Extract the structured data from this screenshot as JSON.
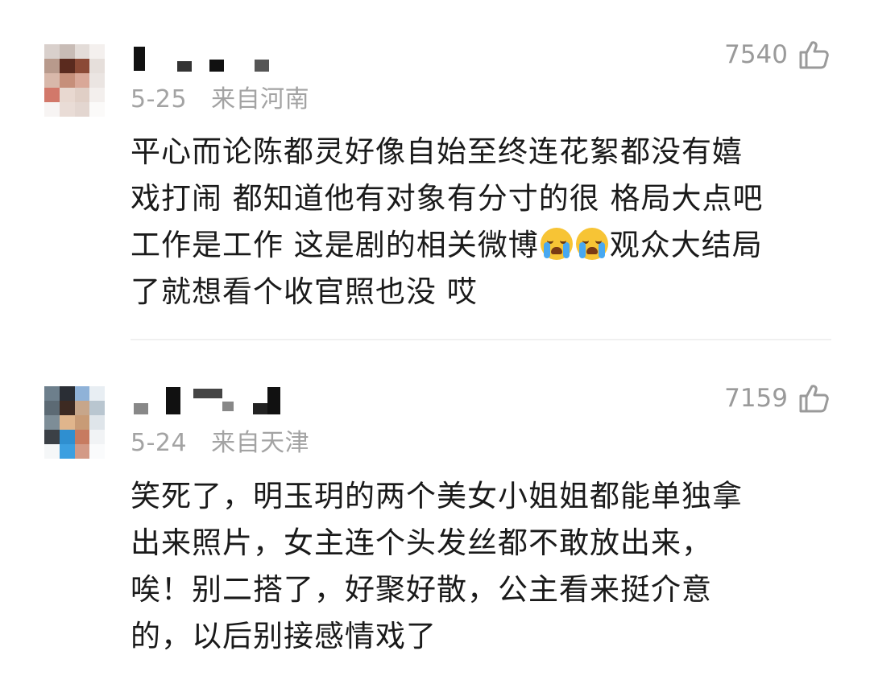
{
  "comments": [
    {
      "date": "5-25",
      "location": "来自河南",
      "likes": "7540",
      "text_a": "平心而论陈都灵好像自始至终连花絮都没有嬉\n戏打闹 都知道他有对象有分寸的很 格局大点吧\n工作是工作 这是剧的相关微博",
      "emoji": "crying-face-emoji",
      "text_b": "观众大结局\n了就想看个收官照也没 哎"
    },
    {
      "date": "5-24",
      "location": "来自天津",
      "likes": "7159",
      "text": "笑死了，明玉玥的两个美女小姐姐都能单独拿\n出来照片，女主连个头发丝都不敢放出来，\n唉！别二搭了，好聚好散，公主看来挺介意\n的，以后别接感情戏了"
    }
  ],
  "colors": {
    "meta_text": "#a3a3a3",
    "like_text": "#9a9a9a",
    "body_text": "#1a1a1a",
    "divider": "#f0f0f0"
  },
  "icons": {
    "like": "thumbs-up-outline-icon",
    "avatar": "pixelated-avatar"
  }
}
